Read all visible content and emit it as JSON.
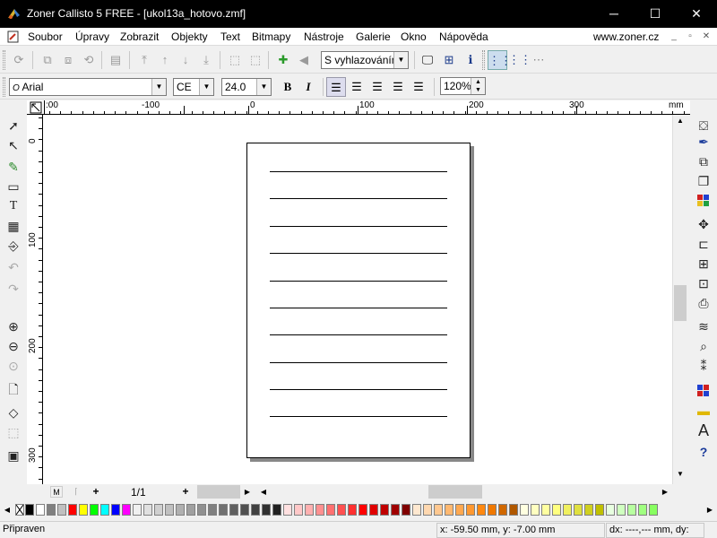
{
  "window": {
    "title": "Zoner Callisto 5 FREE - [ukol13a_hotovo.zmf]",
    "minimize": "─",
    "maximize": "☐",
    "close": "✕"
  },
  "menu": {
    "items": [
      "Soubor",
      "Úpravy",
      "Zobrazit",
      "Objekty",
      "Text",
      "Bitmapy",
      "Nástroje",
      "Galerie",
      "Okno",
      "Nápověda"
    ],
    "website": "www.zoner.cz",
    "mdi": [
      "_",
      "▫",
      "✕"
    ]
  },
  "toolbar": {
    "smoothing_select": "S vyhlazováním"
  },
  "format": {
    "font_name": "Arial",
    "font_prefix": "O",
    "charset": "CE",
    "font_size": "24.0",
    "bold": "B",
    "italic": "I",
    "zoom": "120%"
  },
  "rulers": {
    "h_labels": [
      ":00",
      "-100",
      "0",
      "100",
      "200",
      "300",
      "mm"
    ],
    "v_labels": [
      "0",
      "100",
      "200",
      "300"
    ]
  },
  "page_nav": {
    "first": "M",
    "prev": "⌈",
    "add": "+",
    "page": "1/1",
    "add2": "+"
  },
  "status": {
    "message": "Připraven",
    "coords": "x: -59.50 mm, y: -7.00 mm",
    "delta": "dx: ----,--- mm, dy:"
  },
  "palette_colors": [
    "#000000",
    "#ffffff",
    "#808080",
    "#c0c0c0",
    "#ff0000",
    "#ffff00",
    "#00ff00",
    "#00ffff",
    "#0000ff",
    "#ff00ff",
    "#f0f0f0",
    "#e0e0e0",
    "#d0d0d0",
    "#c0c0c0",
    "#b0b0b0",
    "#a0a0a0",
    "#909090",
    "#808080",
    "#707070",
    "#606060",
    "#505050",
    "#404040",
    "#303030",
    "#202020",
    "#ffe0e0",
    "#ffc8c8",
    "#ffb0b0",
    "#ff9090",
    "#ff7070",
    "#ff5050",
    "#ff3030",
    "#ff0000",
    "#e00000",
    "#c00000",
    "#a00000",
    "#800000",
    "#ffe8d0",
    "#ffd8b0",
    "#ffc890",
    "#ffb870",
    "#ffa850",
    "#ff9830",
    "#ff8810",
    "#f07800",
    "#d06800",
    "#b05800",
    "#ffffe0",
    "#ffffc0",
    "#ffffa0",
    "#ffff80",
    "#f0f060",
    "#e0e040",
    "#d0d020",
    "#c0c000",
    "#e8ffe0",
    "#d0ffc0",
    "#b8ffa0",
    "#a0ff80",
    "#88ff60"
  ]
}
